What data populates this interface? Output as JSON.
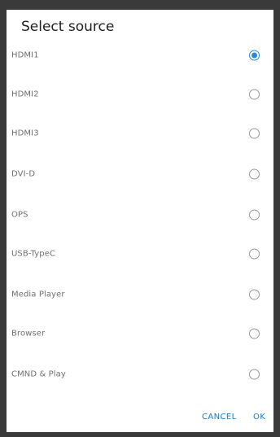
{
  "dialog": {
    "title": "Select source",
    "options": [
      {
        "label": "HDMI1",
        "selected": true
      },
      {
        "label": "HDMI2",
        "selected": false
      },
      {
        "label": "HDMI3",
        "selected": false
      },
      {
        "label": "DVI-D",
        "selected": false
      },
      {
        "label": "OPS",
        "selected": false
      },
      {
        "label": "USB-TypeC",
        "selected": false
      },
      {
        "label": "Media Player",
        "selected": false
      },
      {
        "label": "Browser",
        "selected": false
      },
      {
        "label": "CMND & Play",
        "selected": false
      }
    ],
    "cancel_label": "CANCEL",
    "ok_label": "OK"
  },
  "colors": {
    "accent": "#2a8ad4",
    "button_text": "#1a79c4",
    "backdrop": "#3a3a3a"
  }
}
